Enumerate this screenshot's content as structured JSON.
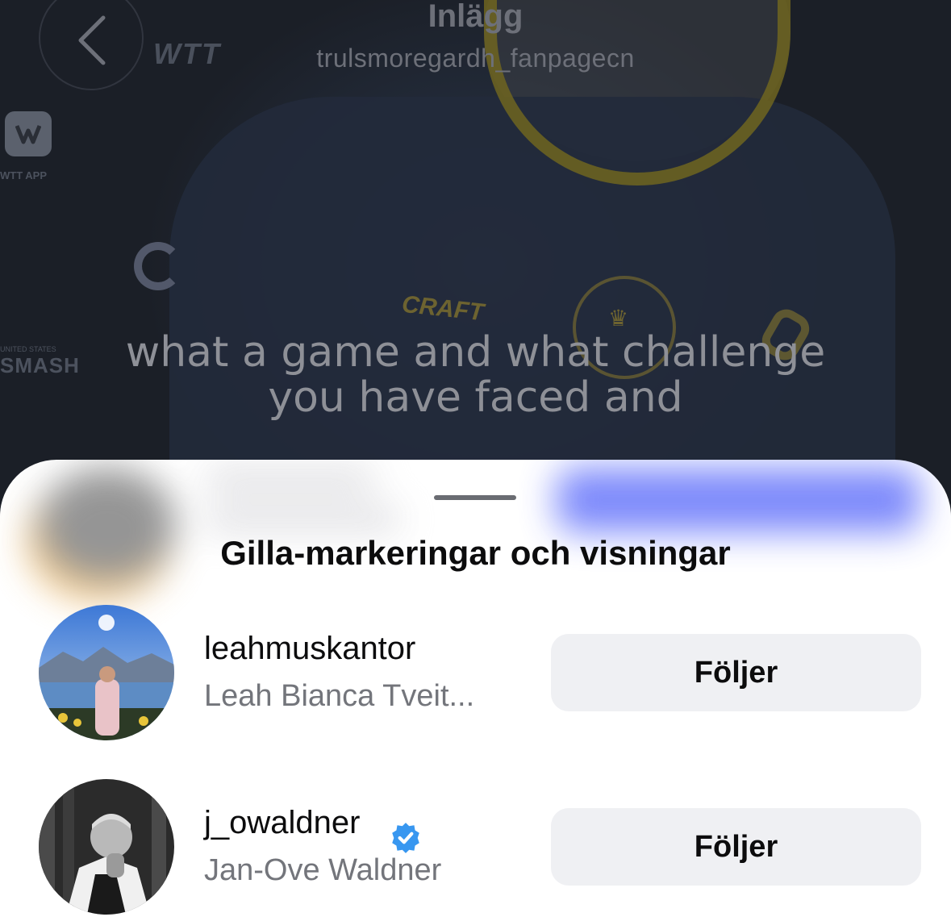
{
  "header": {
    "title": "Inlägg",
    "subtitle": "trulsmoregardh_fanpagecn"
  },
  "video": {
    "caption_line1": "what a game and what challenge",
    "caption_line2": "you have faced and",
    "sponsor_text": "WTT",
    "app_label": "WTT APP",
    "smash_label": "SMASH",
    "smash_sub": "UNITED STATES",
    "craft_label": "CRAFT"
  },
  "sheet": {
    "title": "Gilla-markeringar och visningar",
    "users": [
      {
        "username": "leahmuskantor",
        "fullname": "Leah Bianca Tveit...",
        "button_label": "Följer",
        "verified": false
      },
      {
        "username": "j_owaldner",
        "fullname": "Jan-Ove Waldner",
        "button_label": "Följer",
        "verified": true
      }
    ]
  },
  "colors": {
    "verified_badge": "#3897f0",
    "follow_button_bg": "#eff0f3",
    "blurred_button": "#6f7dfb"
  }
}
